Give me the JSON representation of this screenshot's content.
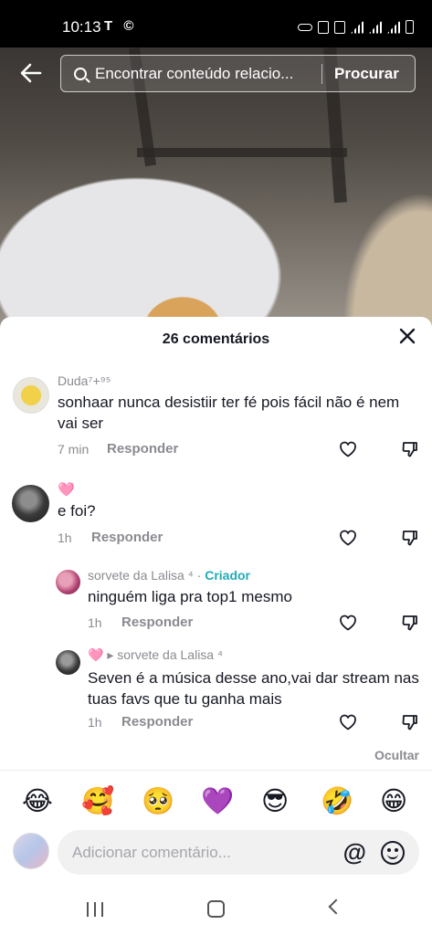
{
  "status_bar": {
    "time": "10:13",
    "left_icons": "T ©"
  },
  "search": {
    "placeholder": "Encontrar conteúdo relacio...",
    "button_label": "Procurar"
  },
  "sheet": {
    "title": "26 comentários",
    "hide_label": "Ocultar"
  },
  "comments": [
    {
      "username": "Duda⁷+⁹⁵",
      "text": "sonhaar nunca desistiir ter fé pois fácil não é nem vai ser",
      "time": "7 min",
      "reply_label": "Responder"
    },
    {
      "username": "🩷",
      "text": "e foi?",
      "time": "1h",
      "reply_label": "Responder"
    },
    {
      "username": "sorvete da Lalisa ⁴",
      "creator_sep": " · ",
      "creator_tag": "Criador",
      "text": "ninguém liga pra top1 mesmo",
      "time": "1h",
      "reply_label": "Responder"
    },
    {
      "username": "🩷",
      "reply_to": "▸ sorvete da Lalisa ⁴",
      "text": "Seven é a música desse ano,vai dar stream nas tuas favs que tu ganha mais",
      "time": "1h",
      "reply_label": "Responder"
    }
  ],
  "emoji_bar": [
    "😂",
    "🥰",
    "🥺",
    "💜",
    "😎",
    "🤣",
    "😁"
  ],
  "composer": {
    "placeholder": "Adicionar comentário...",
    "at_label": "@"
  },
  "colors": {
    "creator": "#20aab5",
    "muted_text": "#8a8b91",
    "text": "#161823"
  }
}
